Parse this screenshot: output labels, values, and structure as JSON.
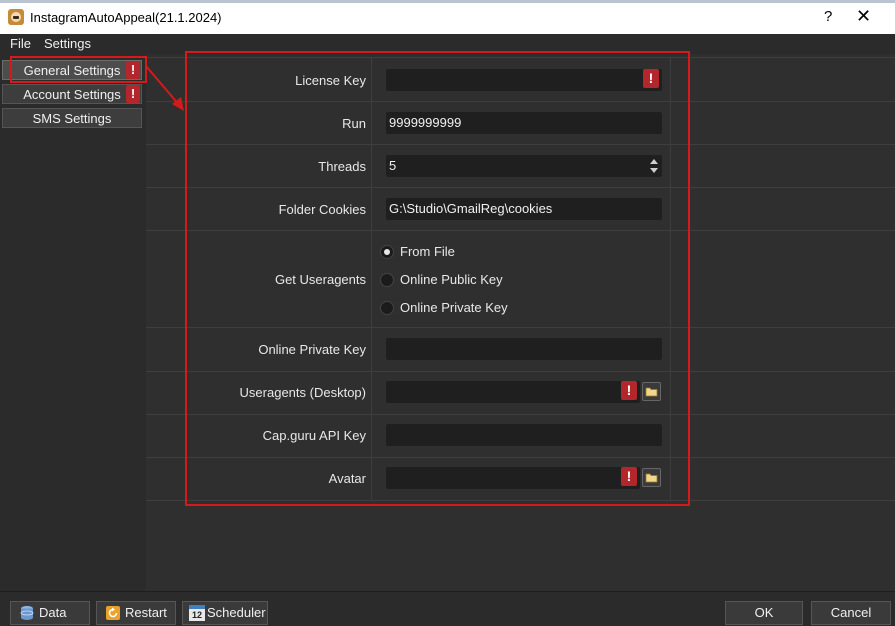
{
  "window": {
    "title": "InstagramAutoAppeal(21.1.2024)",
    "help_glyph": "?",
    "close_glyph": "✕"
  },
  "menu": {
    "file": "File",
    "settings": "Settings"
  },
  "sidebar": {
    "items": [
      {
        "label": "General Settings",
        "warning": "!"
      },
      {
        "label": "Account Settings",
        "warning": "!"
      },
      {
        "label": "SMS Settings"
      }
    ]
  },
  "form": {
    "license_key": {
      "label": "License Key",
      "value": "",
      "warning": "!"
    },
    "run": {
      "label": "Run",
      "value": "9999999999"
    },
    "threads": {
      "label": "Threads",
      "value": "5"
    },
    "folder_cookies": {
      "label": "Folder Cookies",
      "value": "G:\\Studio\\GmailReg\\cookies"
    },
    "get_useragents": {
      "label": "Get Useragents",
      "options": [
        "From File",
        "Online Public Key",
        "Online Private Key"
      ],
      "selected": "From File"
    },
    "online_private_key": {
      "label": "Online Private Key",
      "value": ""
    },
    "useragents_desktop": {
      "label": "Useragents (Desktop)",
      "value": "",
      "warning": "!"
    },
    "cap_guru": {
      "label": "Cap.guru API Key",
      "value": ""
    },
    "avatar": {
      "label": "Avatar",
      "value": "",
      "warning": "!"
    }
  },
  "footer": {
    "data": "Data",
    "restart": "Restart",
    "scheduler": "Scheduler",
    "ok": "OK",
    "cancel": "Cancel",
    "scheduler_icon_text": "12"
  },
  "colors": {
    "warning": "#b3262c",
    "highlight": "#d41a1a",
    "background": "#2f2f2f"
  },
  "icons": [
    "app-icon",
    "help-icon",
    "close-icon",
    "warning-icon",
    "folder-icon",
    "database-icon",
    "restart-icon",
    "calendar-icon"
  ]
}
